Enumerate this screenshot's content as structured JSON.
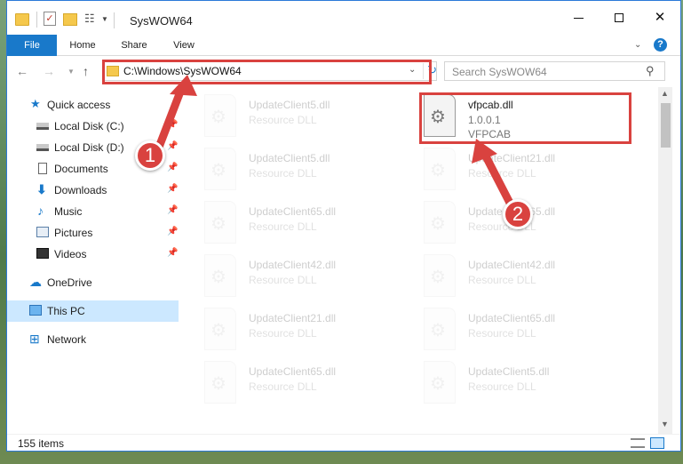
{
  "window": {
    "title": "SysWOW64",
    "controls": {
      "minimize": "",
      "maximize": "",
      "close": "✕"
    }
  },
  "ribbon": {
    "tabs": [
      "File",
      "Home",
      "Share",
      "View"
    ],
    "help": "?"
  },
  "nav": {
    "address": "C:\\Windows\\SysWOW64",
    "search_placeholder": "Search SysWOW64"
  },
  "sidebar": {
    "items": [
      {
        "label": "Quick access",
        "icon": "star-icon"
      },
      {
        "label": "Local Disk (C:)",
        "icon": "drive-icon",
        "pinned": true
      },
      {
        "label": "Local Disk (D:)",
        "icon": "drive-icon",
        "pinned": true
      },
      {
        "label": "Documents",
        "icon": "documents-icon",
        "pinned": true
      },
      {
        "label": "Downloads",
        "icon": "downloads-icon",
        "pinned": true
      },
      {
        "label": "Music",
        "icon": "music-icon",
        "pinned": true
      },
      {
        "label": "Pictures",
        "icon": "pictures-icon",
        "pinned": true
      },
      {
        "label": "Videos",
        "icon": "videos-icon",
        "pinned": true
      },
      {
        "label": "OneDrive",
        "icon": "onedrive-icon"
      },
      {
        "label": "This PC",
        "icon": "pc-icon",
        "selected": true
      },
      {
        "label": "Network",
        "icon": "network-icon"
      }
    ]
  },
  "files": {
    "left": [
      {
        "name": "UpdateClient5.dll",
        "desc": "Resource DLL"
      },
      {
        "name": "UpdateClient5.dll",
        "desc": "Resource DLL"
      },
      {
        "name": "UpdateClient65.dll",
        "desc": "Resource DLL"
      },
      {
        "name": "UpdateClient42.dll",
        "desc": "Resource DLL"
      },
      {
        "name": "UpdateClient21.dll",
        "desc": "Resource DLL"
      },
      {
        "name": "UpdateClient65.dll",
        "desc": "Resource DLL"
      }
    ],
    "right": [
      {
        "name": "vfpcab.dll",
        "version": "1.0.0.1",
        "desc": "VFPCAB"
      },
      {
        "name": "UpdateClient21.dll",
        "desc": "Resource DLL"
      },
      {
        "name": "UpdateClient65.dll",
        "desc": "Resource DLL"
      },
      {
        "name": "UpdateClient42.dll",
        "desc": "Resource DLL"
      },
      {
        "name": "UpdateClient65.dll",
        "desc": "Resource DLL"
      },
      {
        "name": "UpdateClient5.dll",
        "desc": "Resource DLL"
      }
    ]
  },
  "status": {
    "item_count": "155 items"
  },
  "annotations": {
    "marker1": "1",
    "marker2": "2"
  },
  "colors": {
    "accent": "#1979ca",
    "annotation": "#d9423f",
    "selection": "#cce8ff"
  }
}
